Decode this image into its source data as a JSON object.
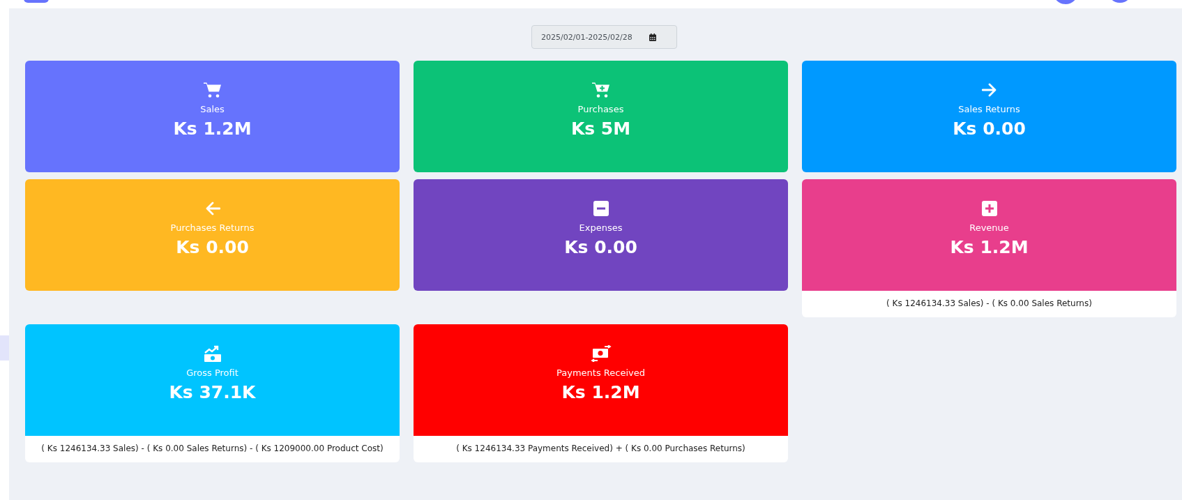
{
  "date_range": {
    "value": "2025/02/01-2025/02/28"
  },
  "cards": [
    {
      "kind": "sales",
      "color": "#6673fd",
      "label": "Sales",
      "value": "Ks 1.2M"
    },
    {
      "kind": "purchases",
      "color": "#0cc277",
      "label": "Purchases",
      "value": "Ks 5M"
    },
    {
      "kind": "sales_returns",
      "color": "#0099ff",
      "label": "Sales Returns",
      "value": "Ks 0.00"
    },
    {
      "kind": "purchases_returns",
      "color": "#ffb822",
      "label": "Purchases Returns",
      "value": "Ks 0.00"
    },
    {
      "kind": "expenses",
      "color": "#7145c0",
      "label": "Expenses",
      "value": "Ks 0.00"
    },
    {
      "kind": "revenue",
      "color": "#e83e8c",
      "label": "Revenue",
      "value": "Ks 1.2M",
      "note": "( Ks 1246134.33 Sales) - ( Ks 0.00 Sales Returns)"
    },
    {
      "kind": "gross_profit",
      "color": "#00c4ff",
      "label": "Gross Profit",
      "value": "Ks 37.1K",
      "note": "( Ks 1246134.33 Sales) - ( Ks 0.00 Sales Returns) - ( Ks 1209000.00 Product Cost)"
    },
    {
      "kind": "payments_received",
      "color": "#ff0000",
      "label": "Payments Received",
      "value": "Ks 1.2M",
      "note": "( Ks 1246134.33 Payments Received) + ( Ks 0.00 Purchases Returns)"
    }
  ]
}
